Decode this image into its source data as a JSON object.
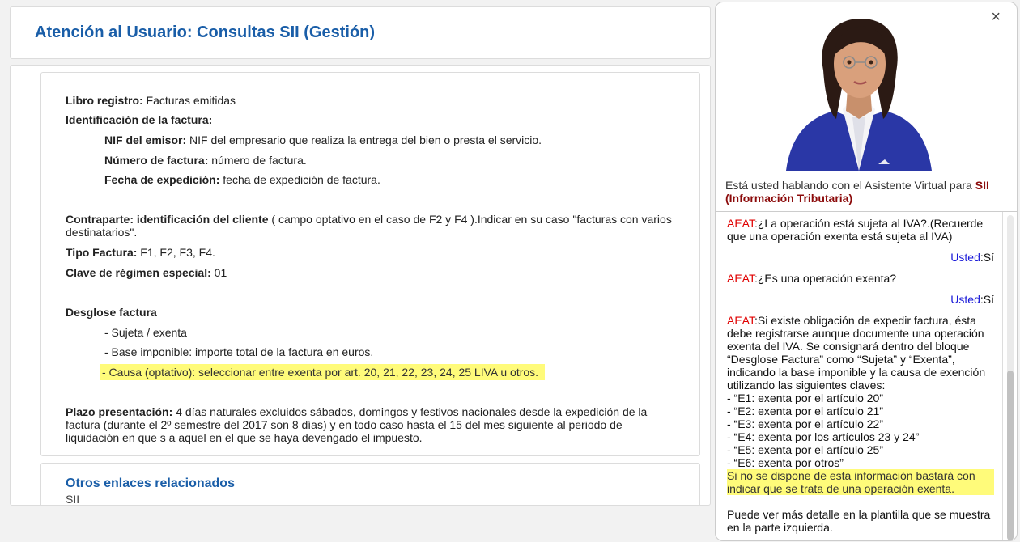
{
  "page": {
    "title": "Atención al Usuario: Consultas SII (Gestión)"
  },
  "details": {
    "libro_label": "Libro registro:",
    "libro_value": " Facturas emitidas",
    "ident_label": "Identificación de la factura:",
    "nif_label": "NIF del emisor:",
    "nif_value": " NIF del empresario que realiza la entrega del bien o presta el servicio.",
    "numero_label": "Número de factura:",
    "numero_value": " número de factura.",
    "fecha_label": "Fecha de expedición:",
    "fecha_value": " fecha de expedición de factura.",
    "contraparte_label": "Contraparte: identificación del cliente",
    "contraparte_value": " ( campo optativo en el caso de F2 y F4 ).Indicar en su caso \"facturas con varios destinatarios\".",
    "tipo_label": "Tipo Factura:",
    "tipo_value": " F1, F2, F3, F4.",
    "clave_label": "Clave de régimen especial:",
    "clave_value": " 01",
    "desglose_label": "Desglose factura",
    "desglose_items": [
      "- Sujeta / exenta",
      "- Base imponible: importe total de la factura en euros.",
      "- Causa (optativo): seleccionar entre exenta por art. 20, 21, 22, 23, 24, 25 LIVA u otros."
    ],
    "plazo_label": "Plazo presentación:",
    "plazo_value": " 4 días naturales excluidos sábados, domingos y festivos nacionales desde la expedición de la factura (durante el 2º semestre del 2017 son 8 días) y en todo caso hasta el 15 del mes siguiente al periodo de liquidación en que s a aquel en el que se haya devengado el impuesto."
  },
  "links": {
    "title": "Otros enlaces relacionados",
    "item": "SII"
  },
  "assistant": {
    "close_glyph": "×",
    "talking_prefix": "Está usted hablando con el Asistente Virtual para ",
    "talking_subject": "SII (Información Tributaria)",
    "aeat_label": "AEAT",
    "user_label": "Usted",
    "q1": ":¿La operación está sujeta al IVA?.(Recuerde que una operación exenta está sujeta al IVA)",
    "a1": ":Sí",
    "q2": ":¿Es una operación exenta?",
    "a2": ":Sí",
    "reply_intro": ":Si existe obligación de expedir factura, ésta debe registrarse aunque documente una operación exenta del IVA. Se consignará dentro del bloque “Desglose Factura” como “Sujeta” y “Exenta”, indicando la base imponible y la causa de exención utilizando las siguientes claves:",
    "codes": [
      "- “E1: exenta por el artículo 20”",
      "- “E2: exenta por el artículo 21”",
      "- “E3: exenta por el artículo 22”",
      "- “E4: exenta por los artículos 23 y 24”",
      "- “E5: exenta por el artículo 25”",
      "- “E6: exenta por otros”"
    ],
    "highlight": "Si no se dispone de esta información bastará con indicar que se trata de una operación exenta.",
    "footer": "Puede ver más detalle en la plantilla que se muestra en la parte izquierda."
  }
}
